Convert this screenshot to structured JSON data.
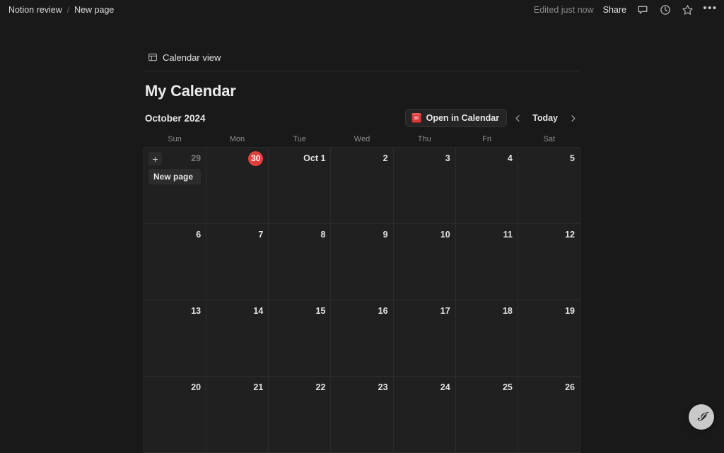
{
  "topbar": {
    "breadcrumb": [
      {
        "label": "Notion review"
      },
      {
        "label": "New page"
      }
    ],
    "separator": "/",
    "edited_status": "Edited just now",
    "share_label": "Share",
    "icons": [
      {
        "name": "comment-icon"
      },
      {
        "name": "history-clock-icon"
      },
      {
        "name": "star-favorite-icon"
      },
      {
        "name": "more-options-icon",
        "glyph": "•••"
      }
    ]
  },
  "view_tab": {
    "label": "Calendar view",
    "icon": "calendar-view-icon"
  },
  "page": {
    "title": "My Calendar"
  },
  "calendar_toolbar": {
    "month_label": "October 2024",
    "open_in_calendar_label": "Open in Calendar",
    "open_in_calendar_icon_day": "30",
    "prev_label": "‹",
    "today_label": "Today",
    "next_label": "›"
  },
  "calendar": {
    "weekdays": [
      "Sun",
      "Mon",
      "Tue",
      "Wed",
      "Thu",
      "Fri",
      "Sat"
    ],
    "add_button_label": "+",
    "weeks": [
      [
        {
          "num": "29",
          "muted": true,
          "today": false,
          "add": true,
          "events": [
            "New page"
          ]
        },
        {
          "num": "30",
          "muted": false,
          "today": true,
          "add": false,
          "events": []
        },
        {
          "num": "Oct 1",
          "muted": false,
          "today": false,
          "add": false,
          "events": []
        },
        {
          "num": "2",
          "muted": false,
          "today": false,
          "add": false,
          "events": []
        },
        {
          "num": "3",
          "muted": false,
          "today": false,
          "add": false,
          "events": []
        },
        {
          "num": "4",
          "muted": false,
          "today": false,
          "add": false,
          "events": []
        },
        {
          "num": "5",
          "muted": false,
          "today": false,
          "add": false,
          "events": []
        }
      ],
      [
        {
          "num": "6",
          "muted": false,
          "today": false,
          "add": false,
          "events": []
        },
        {
          "num": "7",
          "muted": false,
          "today": false,
          "add": false,
          "events": []
        },
        {
          "num": "8",
          "muted": false,
          "today": false,
          "add": false,
          "events": []
        },
        {
          "num": "9",
          "muted": false,
          "today": false,
          "add": false,
          "events": []
        },
        {
          "num": "10",
          "muted": false,
          "today": false,
          "add": false,
          "events": []
        },
        {
          "num": "11",
          "muted": false,
          "today": false,
          "add": false,
          "events": []
        },
        {
          "num": "12",
          "muted": false,
          "today": false,
          "add": false,
          "events": []
        }
      ],
      [
        {
          "num": "13",
          "muted": false,
          "today": false,
          "add": false,
          "events": []
        },
        {
          "num": "14",
          "muted": false,
          "today": false,
          "add": false,
          "events": []
        },
        {
          "num": "15",
          "muted": false,
          "today": false,
          "add": false,
          "events": []
        },
        {
          "num": "16",
          "muted": false,
          "today": false,
          "add": false,
          "events": []
        },
        {
          "num": "17",
          "muted": false,
          "today": false,
          "add": false,
          "events": []
        },
        {
          "num": "18",
          "muted": false,
          "today": false,
          "add": false,
          "events": []
        },
        {
          "num": "19",
          "muted": false,
          "today": false,
          "add": false,
          "events": []
        }
      ],
      [
        {
          "num": "20",
          "muted": false,
          "today": false,
          "add": false,
          "events": []
        },
        {
          "num": "21",
          "muted": false,
          "today": false,
          "add": false,
          "events": []
        },
        {
          "num": "22",
          "muted": false,
          "today": false,
          "add": false,
          "events": []
        },
        {
          "num": "23",
          "muted": false,
          "today": false,
          "add": false,
          "events": []
        },
        {
          "num": "24",
          "muted": false,
          "today": false,
          "add": false,
          "events": []
        },
        {
          "num": "25",
          "muted": false,
          "today": false,
          "add": false,
          "events": []
        },
        {
          "num": "26",
          "muted": false,
          "today": false,
          "add": false,
          "events": []
        }
      ]
    ]
  },
  "fab": {
    "name": "notion-ai-button",
    "glyph": "𝓘"
  },
  "colors": {
    "page_background": "#191919",
    "cell_background": "#202020",
    "grid_line": "#2c2c2c",
    "today_red": "#e0413d",
    "calendar_app_red": "#d93a37",
    "chip_background": "#2c2c2c"
  }
}
